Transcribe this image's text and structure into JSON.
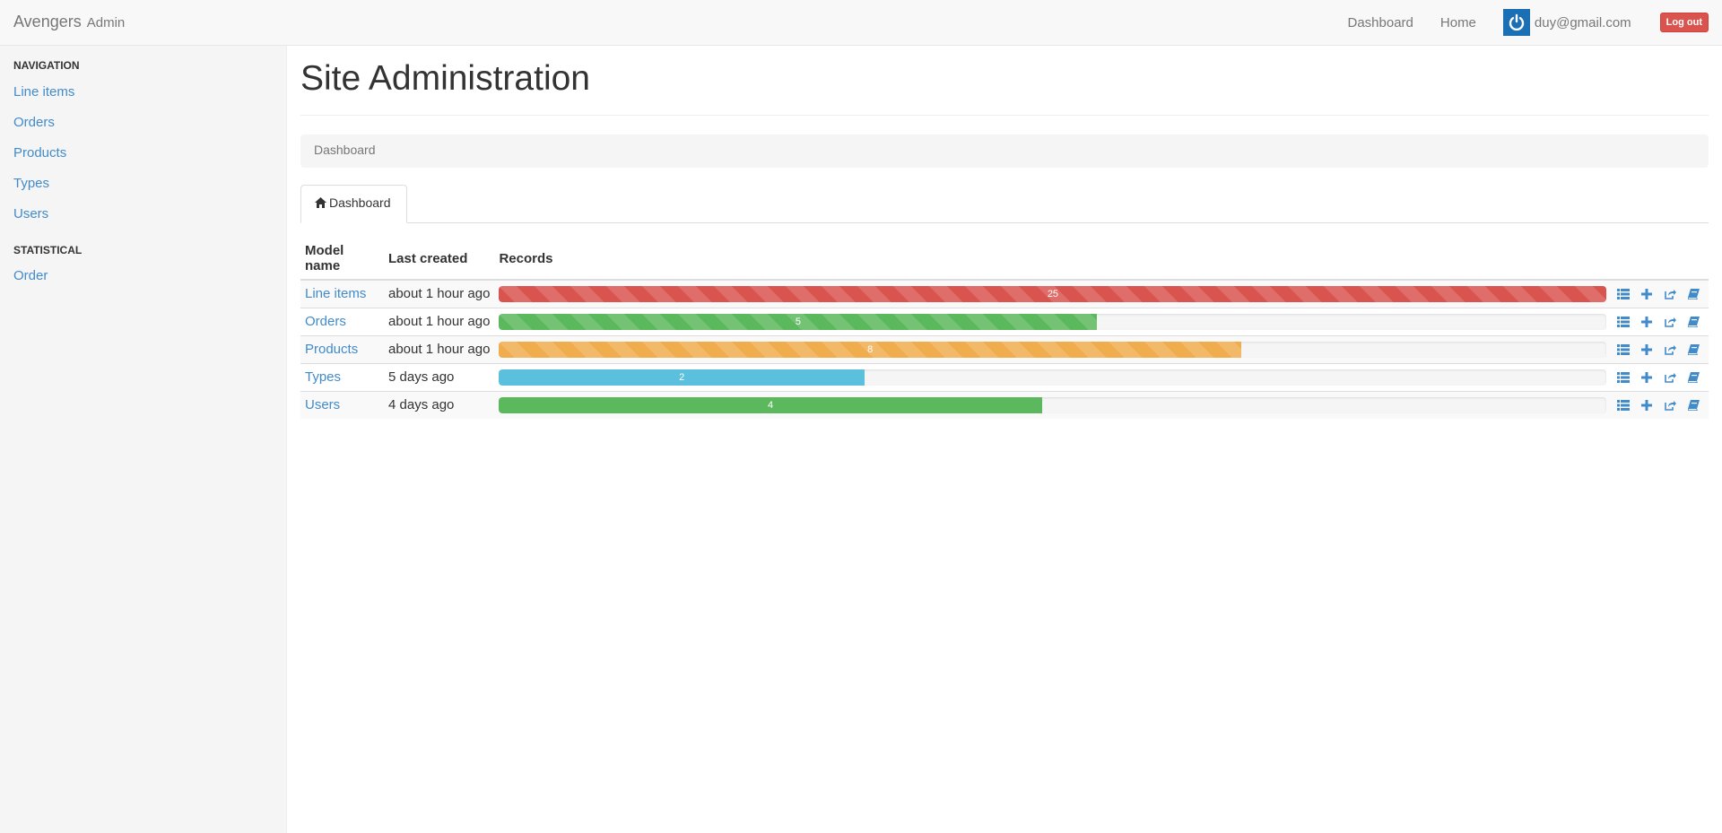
{
  "navbar": {
    "brand": "Avengers",
    "brand_sub": "Admin",
    "links": [
      "Dashboard",
      "Home"
    ],
    "user_email": "duy@gmail.com",
    "logout_label": "Log out"
  },
  "sidebar": {
    "sections": [
      {
        "header": "NAVIGATION",
        "items": [
          "Line items",
          "Orders",
          "Products",
          "Types",
          "Users"
        ]
      },
      {
        "header": "STATISTICAL",
        "items": [
          "Order"
        ]
      }
    ]
  },
  "main": {
    "title": "Site Administration",
    "breadcrumb": "Dashboard",
    "tab_label": "Dashboard",
    "table": {
      "headers": [
        "Model name",
        "Last created",
        "Records"
      ],
      "rows": [
        {
          "name": "Line items",
          "last_created": "about 1 hour ago",
          "records": "25",
          "fill": 1.0,
          "color": "#d9534f",
          "striped": true
        },
        {
          "name": "Orders",
          "last_created": "about 1 hour ago",
          "records": "5",
          "fill": 0.54,
          "color": "#5cb85c",
          "striped": true
        },
        {
          "name": "Products",
          "last_created": "about 1 hour ago",
          "records": "8",
          "fill": 0.67,
          "color": "#f0ad4e",
          "striped": true
        },
        {
          "name": "Types",
          "last_created": "5 days ago",
          "records": "2",
          "fill": 0.33,
          "color": "#5bc0de",
          "striped": false
        },
        {
          "name": "Users",
          "last_created": "4 days ago",
          "records": "4",
          "fill": 0.49,
          "color": "#5cb85c",
          "striped": false
        }
      ],
      "action_icons": [
        "list-icon",
        "plus-icon",
        "share-icon",
        "book-icon"
      ]
    }
  },
  "colors": {
    "link": "#428bca",
    "danger": "#d9534f",
    "success": "#5cb85c",
    "warning": "#f0ad4e",
    "info": "#5bc0de",
    "avatar": "#1a6fb5"
  }
}
